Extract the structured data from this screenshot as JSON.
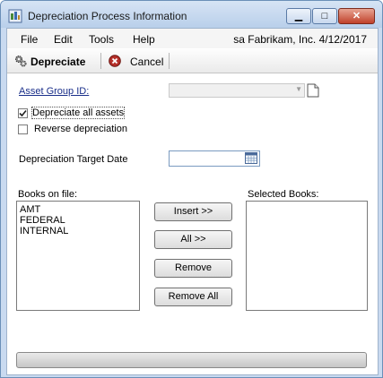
{
  "window": {
    "title": "Depreciation Process Information"
  },
  "menu": {
    "items": [
      "File",
      "Edit",
      "Tools",
      "Help"
    ],
    "user": "sa",
    "company": "Fabrikam, Inc.",
    "date": "4/12/2017"
  },
  "toolbar": {
    "depreciate_label": "Depreciate",
    "cancel_label": "Cancel"
  },
  "form": {
    "asset_group_label": "Asset Group ID:",
    "asset_group_value": "",
    "depreciate_all_label": "Depreciate all assets",
    "depreciate_all_checked": true,
    "reverse_label": "Reverse depreciation",
    "reverse_checked": false,
    "target_date_label": "Depreciation Target Date",
    "target_date_value": ""
  },
  "books": {
    "available_label": "Books on file:",
    "available": [
      "AMT",
      "FEDERAL",
      "INTERNAL"
    ],
    "selected_label": "Selected Books:",
    "selected": []
  },
  "buttons": {
    "insert": "Insert >>",
    "all": "All >>",
    "remove": "Remove",
    "remove_all": "Remove All"
  },
  "progress": {
    "value": 0
  },
  "icons": {
    "app": "window-app-icon",
    "depreciate": "gears-icon",
    "cancel": "cancel-x-icon",
    "lookup": "document-icon",
    "calendar": "calendar-icon",
    "note": "note-icon",
    "help": "help-icon"
  },
  "colors": {
    "link": "#1a2f8a",
    "title_bar": "#c9daf0",
    "close_button": "#c0412a"
  }
}
